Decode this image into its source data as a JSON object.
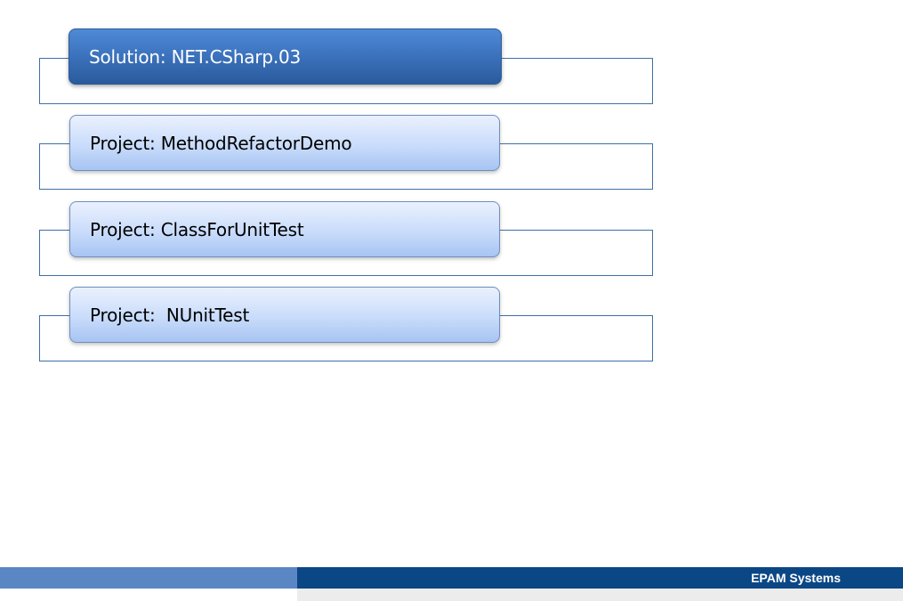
{
  "diagram": {
    "solution": {
      "label": "Solution: NET.CSharp.03"
    },
    "projects": [
      {
        "label": "Project: MethodRefactorDemo"
      },
      {
        "label": "Project: ClassForUnitTest"
      },
      {
        "label": "Project:  NUnitTest"
      }
    ]
  },
  "footer": {
    "brand": "EPAM Systems"
  },
  "colors": {
    "solution_fill": "#3d74bf",
    "project_fill": "#c9dcfb",
    "frame_border": "#3f6fa6",
    "footer_dark": "#0b4784",
    "footer_light": "#5b86c4"
  }
}
